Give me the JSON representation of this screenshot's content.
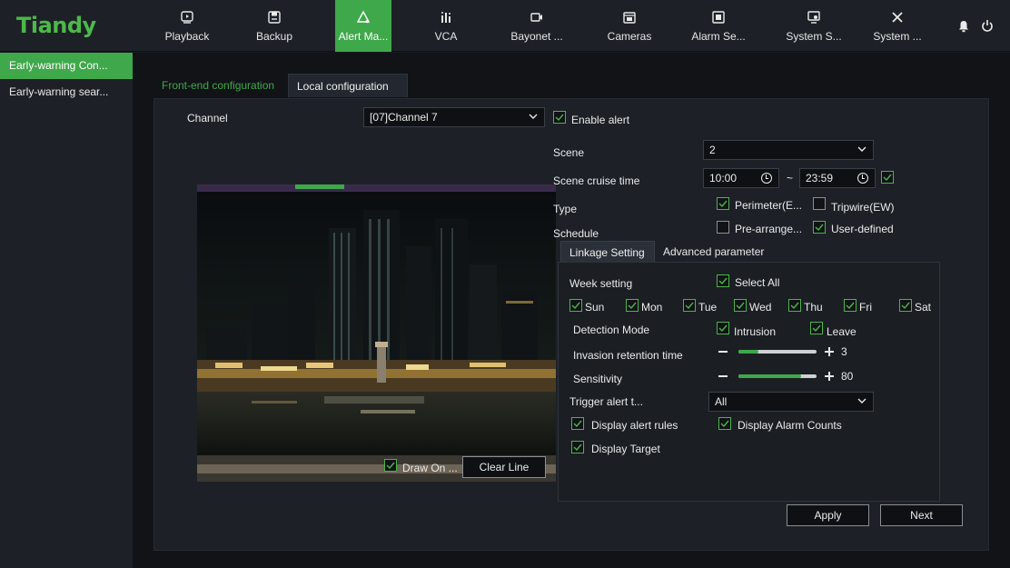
{
  "app": {
    "logo": "Tiandy"
  },
  "nav": [
    {
      "label": "Playback",
      "icon": "playback-icon"
    },
    {
      "label": "Backup",
      "icon": "save-icon"
    },
    {
      "label": "Alert Ma...",
      "icon": "alert-icon",
      "active": true
    },
    {
      "label": "VCA",
      "icon": "vca-icon"
    },
    {
      "label": "Bayonet ...",
      "icon": "camera-small-icon"
    },
    {
      "label": "Cameras",
      "icon": "cameras-icon"
    },
    {
      "label": "Alarm Se...",
      "icon": "alarm-settings-icon"
    },
    {
      "label": "System S...",
      "icon": "system-status-icon"
    },
    {
      "label": "System ...",
      "icon": "system-tools-icon"
    }
  ],
  "sidebar": {
    "items": [
      {
        "label": "Early-warning Con...",
        "active": true
      },
      {
        "label": "Early-warning sear..."
      }
    ]
  },
  "tabs": {
    "front": "Front-end configuration",
    "local": "Local configuration"
  },
  "channel": {
    "label": "Channel",
    "value": "[07]Channel 7"
  },
  "enable_alert": {
    "label": "Enable alert",
    "checked": true
  },
  "scene": {
    "label": "Scene",
    "value": "2"
  },
  "scene_cruise": {
    "label": "Scene cruise time",
    "start": "10:00",
    "tilde": "~",
    "end": "23:59",
    "checked": true
  },
  "type": {
    "label": "Type",
    "perimeter": "Perimeter(E...",
    "tripwire": "Tripwire(EW)",
    "perimeter_checked": true,
    "tripwire_checked": false
  },
  "schedule": {
    "label": "Schedule",
    "pre": "Pre-arrange...",
    "user": "User-defined",
    "pre_checked": false,
    "user_checked": true
  },
  "subtabs": {
    "linkage": "Linkage Setting",
    "advanced": "Advanced parameter"
  },
  "week": {
    "label": "Week setting",
    "select_all": "Select All",
    "days": [
      "Sun",
      "Mon",
      "Tue",
      "Wed",
      "Thu",
      "Fri",
      "Sat"
    ]
  },
  "detection": {
    "label": "Detection Mode",
    "intrusion": "Intrusion",
    "leave": "Leave"
  },
  "invasion": {
    "label": "Invasion retention time",
    "value": "3",
    "fraction": 0.25
  },
  "sensitivity": {
    "label": "Sensitivity",
    "value": "80",
    "fraction": 0.8
  },
  "trigger": {
    "label": "Trigger alert t...",
    "value": "All"
  },
  "display": {
    "rules": "Display alert rules",
    "counts": "Display Alarm Counts",
    "target": "Display Target"
  },
  "video_controls": {
    "draw": "Draw On ...",
    "clear": "Clear Line"
  },
  "buttons": {
    "apply": "Apply",
    "next": "Next"
  },
  "colors": {
    "accent": "#3fa84a",
    "background": "#1d2127"
  }
}
